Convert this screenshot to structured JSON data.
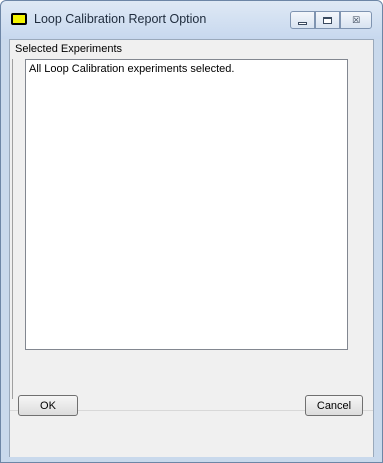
{
  "window": {
    "title": "Loop Calibration Report Option",
    "icon": "app-window-icon",
    "controls": {
      "minimize_icon": "minimize-icon",
      "maximize_icon": "maximize-icon",
      "close_glyph": "☒"
    }
  },
  "group": {
    "label": "Selected Experiments"
  },
  "list": {
    "items": [
      "All Loop Calibration experiments selected."
    ]
  },
  "buttons": {
    "ok_label": "OK",
    "cancel_label": "Cancel"
  }
}
